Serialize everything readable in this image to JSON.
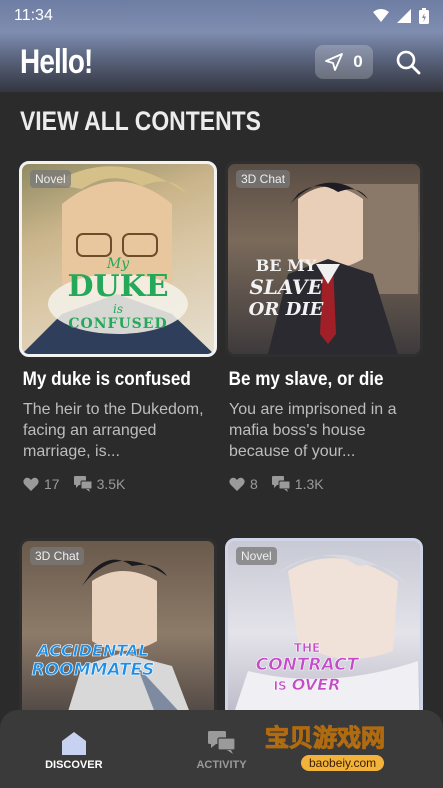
{
  "status_bar": {
    "time": "11:34"
  },
  "header": {
    "greeting": "Hello!",
    "counter": "0"
  },
  "section": {
    "title": "VIEW ALL CONTENTS"
  },
  "cards": [
    {
      "tag": "Novel",
      "title": "My duke is confused",
      "description": "The heir to the Dukedom, facing an arranged marriage, is...",
      "likes": "17",
      "comments": "3.5K",
      "art_text": [
        "My",
        "DUKE",
        "is",
        "CONFUSED"
      ]
    },
    {
      "tag": "3D Chat",
      "title": "Be my slave, or die",
      "description": "You are imprisoned in a mafia boss's house because of your...",
      "likes": "8",
      "comments": "1.3K",
      "art_text": [
        "BE MY",
        "SLAVE",
        "OR DIE"
      ]
    },
    {
      "tag": "3D Chat",
      "art_text": [
        "ACCIDENTAL",
        "ROOMMATES"
      ]
    },
    {
      "tag": "Novel",
      "art_text": [
        "THE",
        "CONTRACT",
        "IS",
        "OVER"
      ]
    }
  ],
  "nav": {
    "discover": "DISCOVER",
    "activity": "ACTIVITY"
  },
  "watermark": {
    "text": "宝贝游戏网",
    "url": "baobeiy.com"
  },
  "colors": {
    "background": "#2b2b2b",
    "header_top": "#7f8db0",
    "nav_bg": "#3a3a3a",
    "watermark": "#f6b73c"
  }
}
